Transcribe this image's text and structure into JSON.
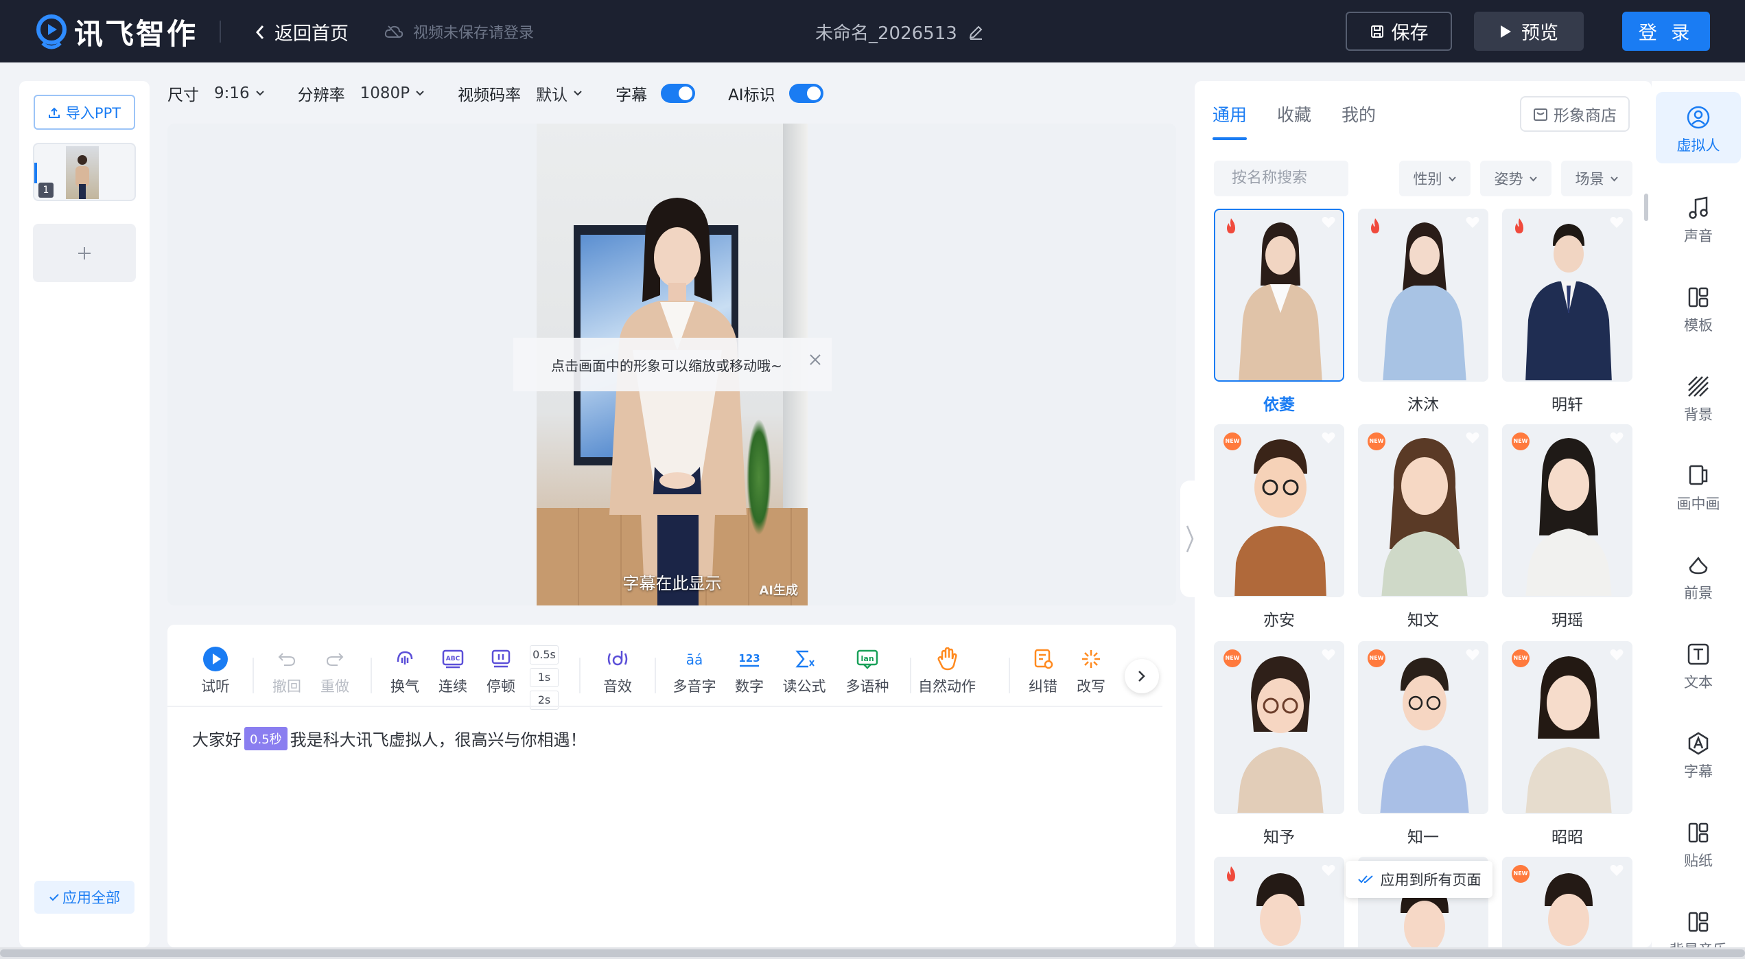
{
  "header": {
    "brand": "讯飞智作",
    "back_label": "返回首页",
    "unsaved_tip": "视频未保存请登录",
    "doc_title": "未命名_2026513",
    "save_label": "保存",
    "preview_label": "预览",
    "login_label": "登 录"
  },
  "pages": {
    "import_label": "导入PPT",
    "page_number": "1",
    "apply_all_label": "应用全部"
  },
  "settings": {
    "size_label": "尺寸",
    "size_value": "9:16",
    "resolution_label": "分辨率",
    "resolution_value": "1080P",
    "bitrate_label": "视频码率",
    "bitrate_value": "默认",
    "subtitle_label": "字幕",
    "subtitle_on": true,
    "ai_mark_label": "AI标识",
    "ai_mark_on": true
  },
  "canvas": {
    "tip": "点击画面中的形象可以缩放或移动哦~",
    "caption": "字幕在此显示",
    "ai_badge": "AI生成"
  },
  "editor": {
    "tools": [
      {
        "name": "listen",
        "label": "试听",
        "icon": "play-icon"
      },
      {
        "name": "undo",
        "label": "撤回",
        "icon": "undo-icon",
        "disabled": true
      },
      {
        "name": "redo",
        "label": "重做",
        "icon": "redo-icon",
        "disabled": true
      },
      {
        "name": "breath",
        "label": "换气",
        "icon": "breath-icon"
      },
      {
        "name": "continuous",
        "label": "连续",
        "icon": "abc-icon"
      },
      {
        "name": "pause",
        "label": "停顿",
        "icon": "pause-icon"
      },
      {
        "name": "sound-effect",
        "label": "音效",
        "icon": "sound-effect-icon"
      },
      {
        "name": "polyphone",
        "label": "多音字",
        "icon": "polyphone-icon"
      },
      {
        "name": "number",
        "label": "数字",
        "icon": "number-icon"
      },
      {
        "name": "formula",
        "label": "读公式",
        "icon": "formula-icon"
      },
      {
        "name": "multilang",
        "label": "多语种",
        "icon": "multilang-icon"
      },
      {
        "name": "gesture",
        "label": "自然动作",
        "icon": "hand-icon"
      },
      {
        "name": "correct",
        "label": "纠错",
        "icon": "correct-icon"
      },
      {
        "name": "rewrite",
        "label": "改写",
        "icon": "sparkle-icon"
      }
    ],
    "pause_options": [
      "0.5s",
      "1s",
      "2s"
    ],
    "script_before": "大家好",
    "script_pause": "0.5秒",
    "script_after": "我是科大讯飞虚拟人，很高兴与你相遇！"
  },
  "library": {
    "tabs": [
      "通用",
      "收藏",
      "我的"
    ],
    "active_tab": "通用",
    "shop_label": "形象商店",
    "search_placeholder": "按名称搜索",
    "filters": [
      "性别",
      "姿势",
      "场景"
    ],
    "avatars": [
      {
        "name": "依菱",
        "badge": "hot",
        "selected": true
      },
      {
        "name": "沐沐",
        "badge": "hot"
      },
      {
        "name": "明轩",
        "badge": "hot"
      },
      {
        "name": "亦安",
        "badge": "new"
      },
      {
        "name": "知文",
        "badge": "new"
      },
      {
        "name": "玥瑶",
        "badge": "new"
      },
      {
        "name": "知予",
        "badge": "new"
      },
      {
        "name": "知一",
        "badge": "new"
      },
      {
        "name": "昭昭",
        "badge": "new"
      }
    ],
    "new_badge_text": "NEW",
    "apply_all_pages": "应用到所有页面"
  },
  "sidenav": [
    {
      "label": "虚拟人",
      "icon": "avatar-icon",
      "active": true
    },
    {
      "label": "声音",
      "icon": "music-note-icon"
    },
    {
      "label": "模板",
      "icon": "template-icon"
    },
    {
      "label": "背景",
      "icon": "background-icon"
    },
    {
      "label": "画中画",
      "icon": "pip-icon"
    },
    {
      "label": "前景",
      "icon": "foreground-icon"
    },
    {
      "label": "文本",
      "icon": "text-icon"
    },
    {
      "label": "字幕",
      "icon": "subtitle-icon"
    },
    {
      "label": "贴纸",
      "icon": "sticker-icon"
    },
    {
      "label": "背景音乐",
      "icon": "bgm-icon"
    }
  ],
  "colors": {
    "accent": "#1a7cf3",
    "header_bg": "#1c2130",
    "pause_tag": "#8a7ef0",
    "new_badge": "#ff7a3d",
    "hot_badge": "#f04a3c"
  }
}
